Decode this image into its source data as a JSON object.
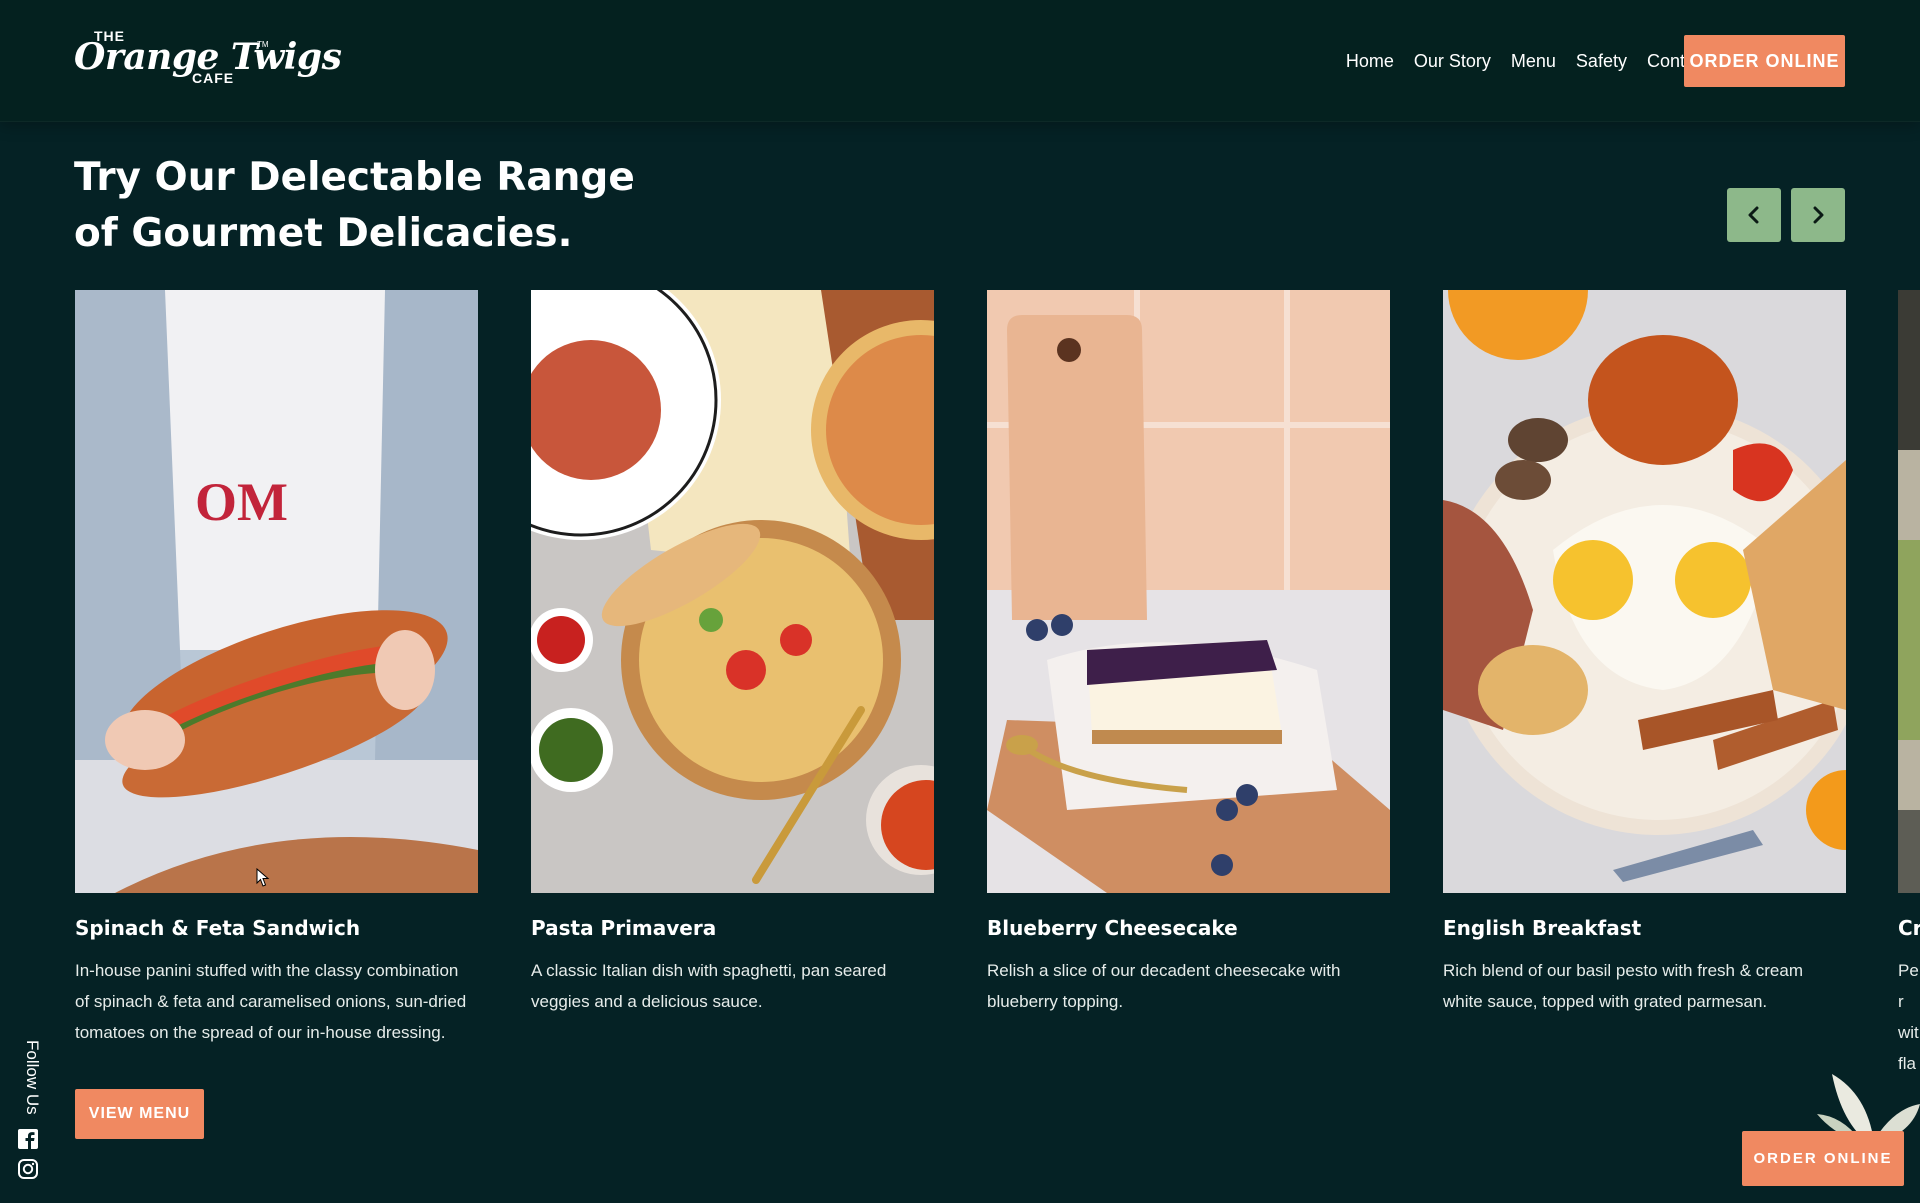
{
  "header": {
    "logo": {
      "the": "THE",
      "brand": "Orange Twigs",
      "tm": "TM",
      "cafe": "CAFE"
    },
    "nav": [
      "Home",
      "Our Story",
      "Menu",
      "Safety",
      "Contact Us"
    ],
    "order_label": "ORDER ONLINE"
  },
  "section": {
    "heading_line1": "Try Our Delectable Range",
    "heading_line2": "of Gourmet Delicacies.",
    "prev_icon": "chevron-left-icon",
    "next_icon": "chevron-right-icon"
  },
  "cards": [
    {
      "title": "Spinach & Feta Sandwich",
      "desc": "In-house panini stuffed with the classy combination of spinach & feta and caramelised onions, sun-dried tomatoes on the spread of our in-house dressing."
    },
    {
      "title": "Pasta Primavera",
      "desc": "A classic Italian dish with spaghetti, pan seared veggies and a delicious sauce."
    },
    {
      "title": "Blueberry Cheesecake",
      "desc": "Relish a slice of our decadent cheesecake with blueberry topping."
    },
    {
      "title": "English Breakfast",
      "desc": "Rich blend of our basil pesto with fresh & cream white sauce, topped with grated parmesan."
    },
    {
      "title": "Cr",
      "desc": "Per wit fla"
    }
  ],
  "view_menu_label": "VIEW MENU",
  "follow_label": "Follow Us",
  "social": [
    "facebook-icon",
    "instagram-icon"
  ],
  "order_bottom_label": "ORDER ONLINE",
  "colors": {
    "background": "#052225",
    "accent": "#f08961",
    "arrow_button": "#8db88a"
  }
}
